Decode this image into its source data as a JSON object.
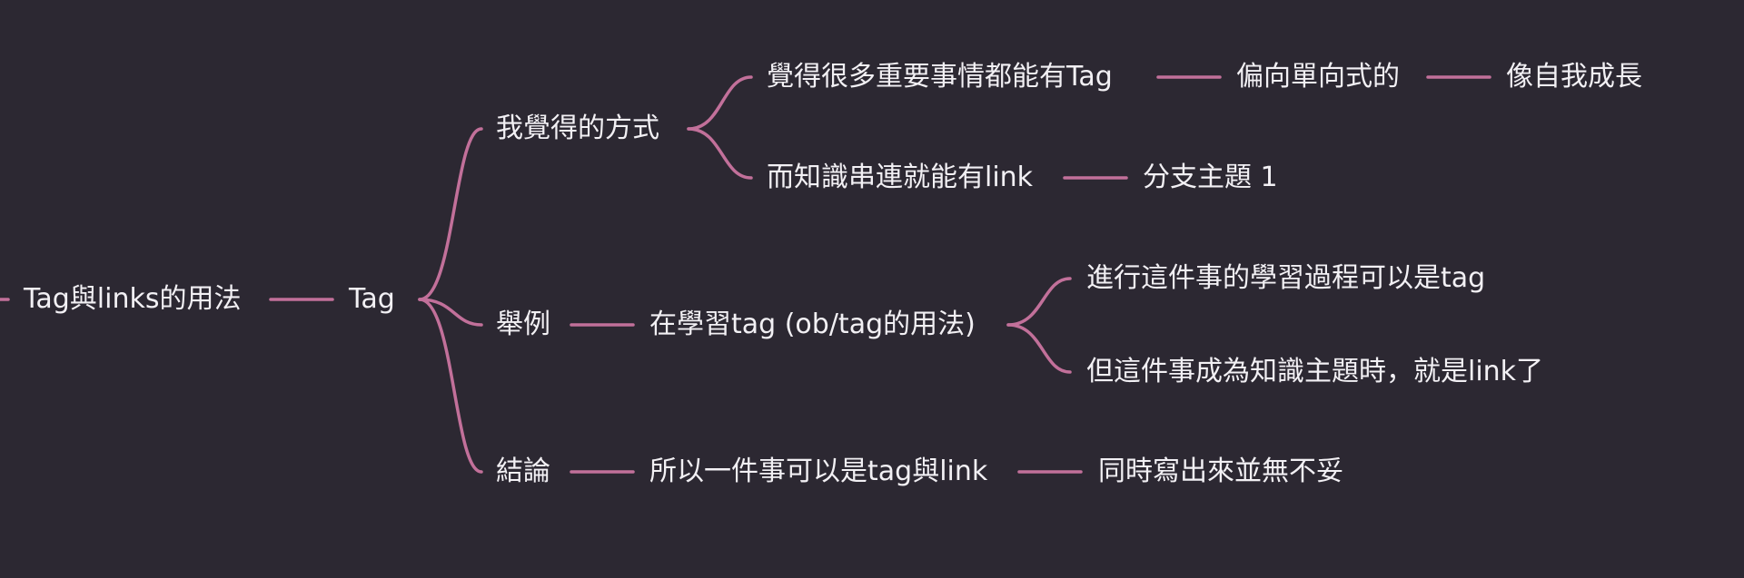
{
  "colors": {
    "background": "#2c2832",
    "link": "#c2709a",
    "text": "#f2f0f4"
  },
  "mindmap": {
    "root": "Tag與links的用法",
    "tag": "Tag",
    "my_way": "我覺得的方式",
    "tag_idea": "覺得很多重要事情都能有Tag",
    "one_way": "偏向單向式的",
    "self_growth": "像自我成長",
    "link_idea": "而知識串連就能有link",
    "subtopic": "分支主題 1",
    "example": "舉例",
    "learning_tag": "在學習tag (ob/tag的用法)",
    "process_tag": "進行這件事的學習過程可以是tag",
    "topic_link": "但這件事成為知識主題時，就是link了",
    "conclusion": "結論",
    "both": "所以一件事可以是tag與link",
    "no_problem": "同時寫出來並無不妥"
  }
}
